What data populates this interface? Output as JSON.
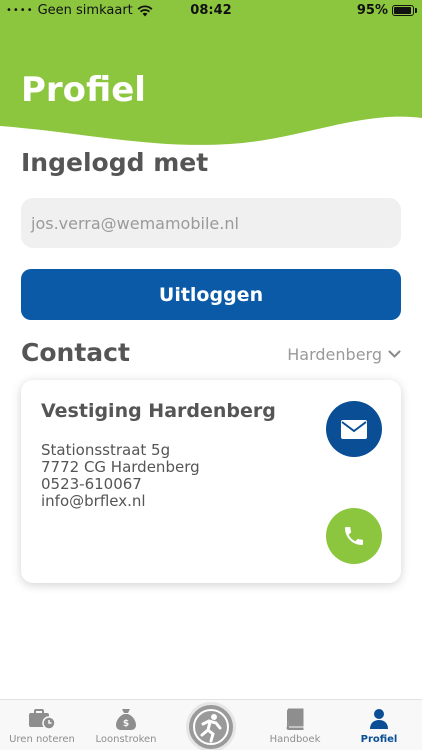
{
  "status": {
    "carrier": "Geen simkaart",
    "time": "08:42",
    "battery": "95%",
    "battery_level": 0.95
  },
  "header": {
    "title": "Profiel"
  },
  "login": {
    "section_title": "Ingelogd met",
    "email": "jos.verra@wemamobile.nl",
    "logout_label": "Uitloggen"
  },
  "contact": {
    "section_title": "Contact",
    "location": "Hardenberg",
    "card": {
      "title": "Vestiging Hardenberg",
      "lines": [
        "Stationsstraat 5g",
        "7772 CG Hardenberg",
        "0523-610067",
        "info@brflex.nl"
      ]
    }
  },
  "tabs": [
    {
      "label": "Uren noteren",
      "icon": "briefcase-clock-icon"
    },
    {
      "label": "Loonstroken",
      "icon": "money-bag-icon"
    },
    {
      "label": "Handboek",
      "icon": "book-icon"
    },
    {
      "label": "Profiel",
      "icon": "person-icon",
      "active": true
    }
  ],
  "colors": {
    "brand_green": "#8cc63f",
    "brand_blue": "#0a5aa8"
  }
}
